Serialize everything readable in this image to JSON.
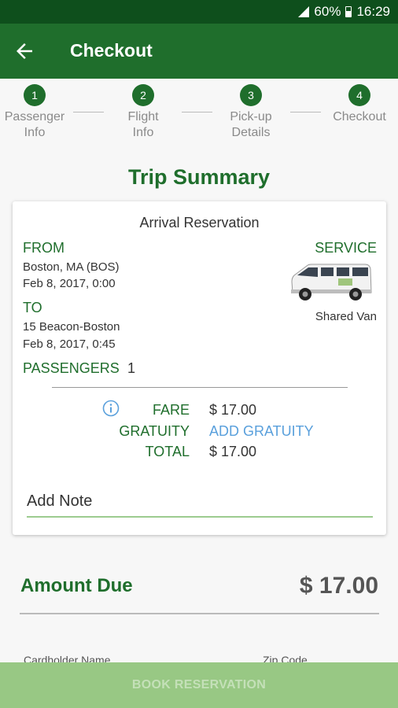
{
  "status_bar": {
    "battery": "60%",
    "time": "16:29"
  },
  "app_bar": {
    "title": "Checkout"
  },
  "steps": [
    {
      "number": "1",
      "label_line1": "Passenger",
      "label_line2": "Info"
    },
    {
      "number": "2",
      "label_line1": "Flight",
      "label_line2": "Info"
    },
    {
      "number": "3",
      "label_line1": "Pick-up",
      "label_line2": "Details"
    },
    {
      "number": "4",
      "label_line1": "Checkout",
      "label_line2": ""
    }
  ],
  "trip": {
    "title": "Trip Summary",
    "reservation_type": "Arrival Reservation",
    "from_label": "FROM",
    "from_place": "Boston, MA (BOS)",
    "from_time": "Feb 8, 2017, 0:00",
    "to_label": "TO",
    "to_place": "15 Beacon-Boston",
    "to_time": "Feb 8, 2017, 0:45",
    "service_label": "SERVICE",
    "service_name": "Shared Van",
    "passengers_label": "PASSENGERS",
    "passengers_count": "1"
  },
  "fare": {
    "fare_label": "FARE",
    "fare_value": "$ 17.00",
    "gratuity_label": "GRATUITY",
    "gratuity_link": "ADD GRATUITY",
    "total_label": "TOTAL",
    "total_value": "$ 17.00"
  },
  "note": {
    "placeholder": "Add Note"
  },
  "amount_due": {
    "label": "Amount Due",
    "value": "$ 17.00"
  },
  "payment_fields": {
    "cardholder_label": "Cardholder Name",
    "zip_label": "Zip Code"
  },
  "book_button": {
    "label": "BOOK RESERVATION"
  },
  "colors": {
    "primary": "#1f6e2c",
    "status_bar": "#0e4f1c",
    "link": "#5aa0dc",
    "button_disabled": "#98c884"
  }
}
